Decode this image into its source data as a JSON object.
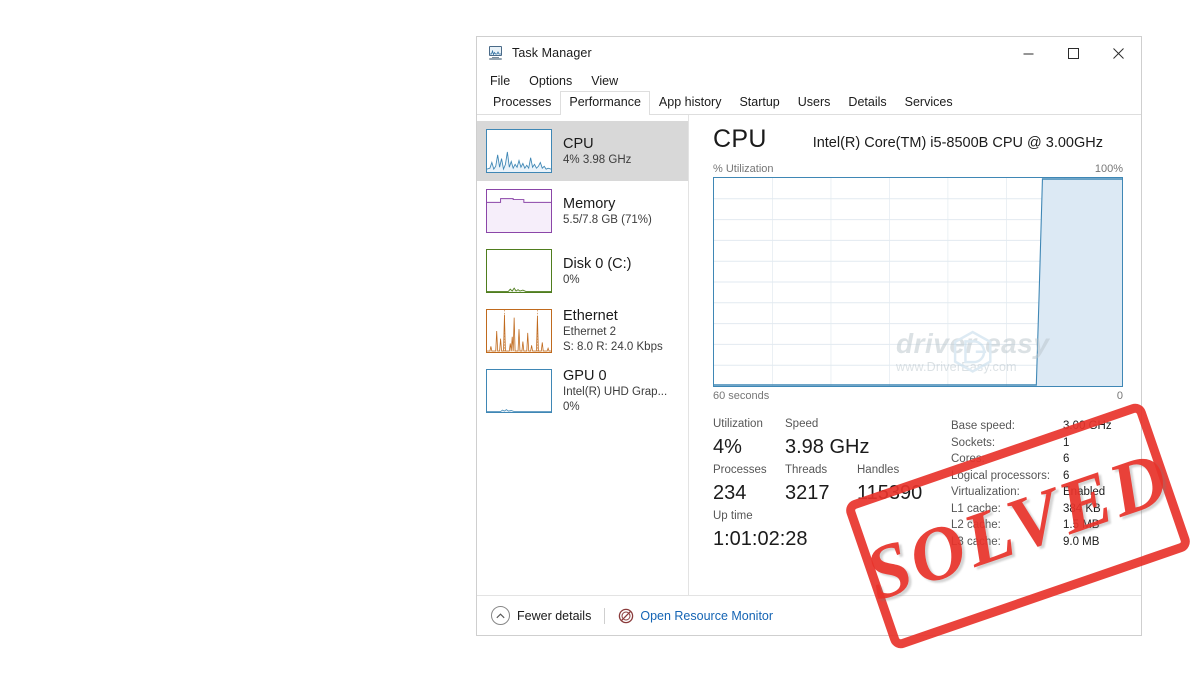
{
  "window": {
    "title": "Task Manager",
    "icon": "task-manager-icon",
    "minimize_label": "—",
    "maximize_label": "□",
    "close_label": "✕"
  },
  "menu": {
    "items": [
      {
        "label": "File"
      },
      {
        "label": "Options"
      },
      {
        "label": "View"
      }
    ]
  },
  "tabs": {
    "items": [
      {
        "label": "Processes",
        "active": false
      },
      {
        "label": "Performance",
        "active": true
      },
      {
        "label": "App history",
        "active": false
      },
      {
        "label": "Startup",
        "active": false
      },
      {
        "label": "Users",
        "active": false
      },
      {
        "label": "Details",
        "active": false
      },
      {
        "label": "Services",
        "active": false
      }
    ]
  },
  "sidebar": {
    "items": [
      {
        "name": "CPU",
        "sub1": "4%  3.98 GHz",
        "sub2": "",
        "selected": true,
        "color": "#3f87b5"
      },
      {
        "name": "Memory",
        "sub1": "5.5/7.8 GB (71%)",
        "sub2": "",
        "selected": false,
        "color": "#8b46a8"
      },
      {
        "name": "Disk 0 (C:)",
        "sub1": "0%",
        "sub2": "",
        "selected": false,
        "color": "#4f7d1e"
      },
      {
        "name": "Ethernet",
        "sub1": "Ethernet 2",
        "sub2": "S: 8.0 R: 24.0 Kbps",
        "selected": false,
        "color": "#c06a1e"
      },
      {
        "name": "GPU 0",
        "sub1": "Intel(R) UHD Grap...",
        "sub2": "0%",
        "selected": false,
        "color": "#3f87b5"
      }
    ]
  },
  "main": {
    "title": "CPU",
    "model": "Intel(R) Core(TM) i5-8500B CPU @ 3.00GHz",
    "graph_label_left": "% Utilization",
    "graph_label_right": "100%",
    "graph_foot_left": "60 seconds",
    "graph_foot_right": "0"
  },
  "watermark": {
    "top": "driver easy",
    "bottom": "www.DriverEasy.com"
  },
  "stats": {
    "utilization_label": "Utilization",
    "utilization_value": "4%",
    "speed_label": "Speed",
    "speed_value": "3.98 GHz",
    "processes_label": "Processes",
    "processes_value": "234",
    "threads_label": "Threads",
    "threads_value": "3217",
    "handles_label": "Handles",
    "handles_value": "115390",
    "uptime_label": "Up time",
    "uptime_value": "1:01:02:28"
  },
  "specs": [
    {
      "key": "Base speed:",
      "value": "3.00 GHz"
    },
    {
      "key": "Sockets:",
      "value": "1"
    },
    {
      "key": "Cores:",
      "value": "6"
    },
    {
      "key": "Logical processors:",
      "value": "6"
    },
    {
      "key": "Virtualization:",
      "value": "Enabled"
    },
    {
      "key": "L1 cache:",
      "value": "384 KB"
    },
    {
      "key": "L2 cache:",
      "value": "1.5 MB"
    },
    {
      "key": "L3 cache:",
      "value": "9.0 MB"
    }
  ],
  "footer": {
    "fewer_details": "Fewer details",
    "resource_monitor": "Open Resource Monitor"
  },
  "stamp": {
    "text": "SOLVED",
    "color": "#e8332b"
  },
  "chart_data": {
    "type": "area",
    "title": "% Utilization",
    "xlabel": "60 seconds",
    "ylabel": "% Utilization",
    "ylim": [
      0,
      100
    ],
    "xlim": [
      60,
      0
    ],
    "grid": true,
    "x_tick_labels": [
      "60 seconds",
      "0"
    ],
    "y_tick_labels": [
      "100%"
    ],
    "grid_columns": 6,
    "grid_rows": 10,
    "series": [
      {
        "name": "CPU utilization",
        "color": "#3f87b5",
        "fill": "#dce9f4",
        "x": [
          60,
          20,
          14,
          12,
          11.5,
          11,
          0
        ],
        "values": [
          0,
          0,
          0,
          0,
          40,
          100,
          100
        ]
      }
    ]
  }
}
